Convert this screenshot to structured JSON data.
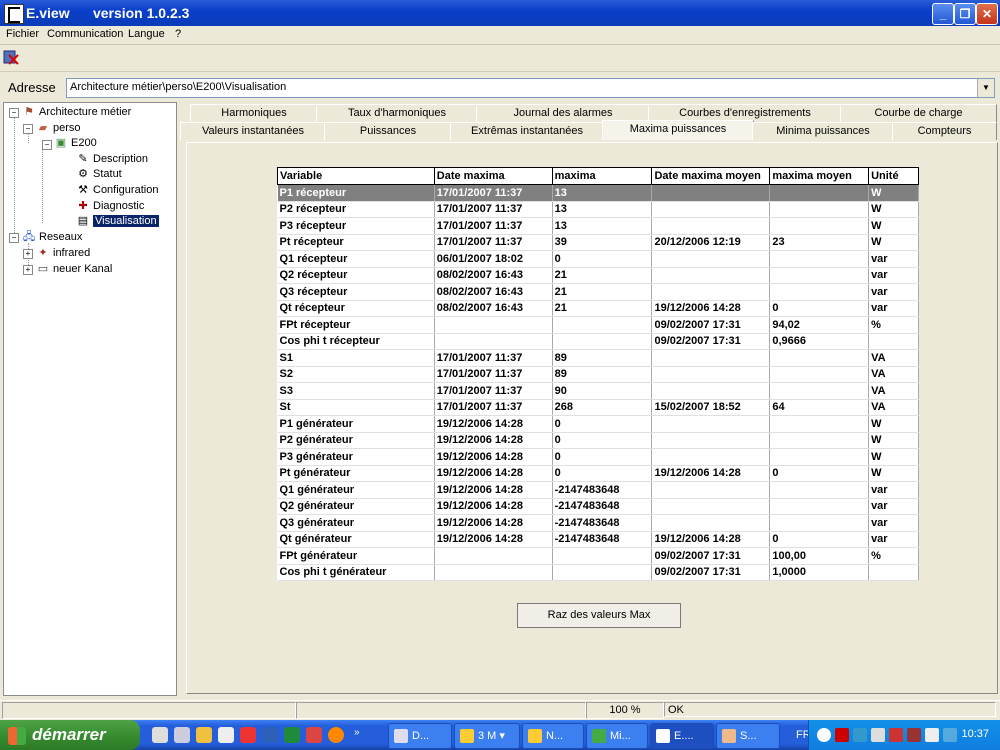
{
  "window": {
    "title": "E.view",
    "version": "version 1.0.2.3"
  },
  "menu": [
    "Fichier",
    "Communication",
    "Langue",
    "?"
  ],
  "address": {
    "label": "Adresse",
    "value": "Architecture métier\\perso\\E200\\Visualisation"
  },
  "tree": {
    "root": "Architecture métier",
    "perso": "perso",
    "device": "E200",
    "children": [
      "Description",
      "Statut",
      "Configuration",
      "Diagnostic",
      "Visualisation"
    ],
    "selected": "Visualisation",
    "networks": "Reseaux",
    "net_children": [
      "infrared",
      "neuer Kanal"
    ]
  },
  "tabs_row1": [
    "Harmoniques",
    "Taux d'harmoniques",
    "Journal des alarmes",
    "Courbes d'enregistrements",
    "Courbe de charge"
  ],
  "tabs_row2": [
    "Valeurs instantanées",
    "Puissances",
    "Extrêmas instantanées",
    "Maxima puissances",
    "Minima puissances",
    "Compteurs"
  ],
  "active_tab": "Maxima puissances",
  "table": {
    "headers": [
      "Variable",
      "Date maxima",
      "maxima",
      "Date maxima moyen",
      "maxima moyen",
      "Unité"
    ],
    "rows": [
      [
        "P1 récepteur",
        "17/01/2007 11:37",
        "13",
        "",
        "",
        "W"
      ],
      [
        "P2 récepteur",
        "17/01/2007 11:37",
        "13",
        "",
        "",
        "W"
      ],
      [
        "P3 récepteur",
        "17/01/2007 11:37",
        "13",
        "",
        "",
        "W"
      ],
      [
        "Pt récepteur",
        "17/01/2007 11:37",
        "39",
        "20/12/2006 12:19",
        "23",
        "W"
      ],
      [
        "Q1 récepteur",
        "06/01/2007 18:02",
        "0",
        "",
        "",
        "var"
      ],
      [
        "Q2 récepteur",
        "08/02/2007 16:43",
        "21",
        "",
        "",
        "var"
      ],
      [
        "Q3 récepteur",
        "08/02/2007 16:43",
        "21",
        "",
        "",
        "var"
      ],
      [
        "Qt récepteur",
        "08/02/2007 16:43",
        "21",
        "19/12/2006 14:28",
        "0",
        "var"
      ],
      [
        "FPt récepteur",
        "",
        "",
        "09/02/2007 17:31",
        "94,02",
        "%"
      ],
      [
        "Cos phi t récepteur",
        "",
        "",
        "09/02/2007 17:31",
        "0,9666",
        ""
      ],
      [
        "S1",
        "17/01/2007 11:37",
        "89",
        "",
        "",
        "VA"
      ],
      [
        "S2",
        "17/01/2007 11:37",
        "89",
        "",
        "",
        "VA"
      ],
      [
        "S3",
        "17/01/2007 11:37",
        "90",
        "",
        "",
        "VA"
      ],
      [
        "St",
        "17/01/2007 11:37",
        "268",
        "15/02/2007 18:52",
        "64",
        "VA"
      ],
      [
        "P1 générateur",
        "19/12/2006 14:28",
        "0",
        "",
        "",
        "W"
      ],
      [
        "P2 générateur",
        "19/12/2006 14:28",
        "0",
        "",
        "",
        "W"
      ],
      [
        "P3 générateur",
        "19/12/2006 14:28",
        "0",
        "",
        "",
        "W"
      ],
      [
        "Pt générateur",
        "19/12/2006 14:28",
        "0",
        "19/12/2006 14:28",
        "0",
        "W"
      ],
      [
        "Q1 générateur",
        "19/12/2006 14:28",
        "-2147483648",
        "",
        "",
        "var"
      ],
      [
        "Q2 générateur",
        "19/12/2006 14:28",
        "-2147483648",
        "",
        "",
        "var"
      ],
      [
        "Q3 générateur",
        "19/12/2006 14:28",
        "-2147483648",
        "",
        "",
        "var"
      ],
      [
        "Qt générateur",
        "19/12/2006 14:28",
        "-2147483648",
        "19/12/2006 14:28",
        "0",
        "var"
      ],
      [
        "FPt générateur",
        "",
        "",
        "09/02/2007 17:31",
        "100,00",
        "%"
      ],
      [
        "Cos phi t générateur",
        "",
        "",
        "09/02/2007 17:31",
        "1,0000",
        ""
      ]
    ],
    "selected_row": 0
  },
  "reset_button": "Raz des valeurs Max",
  "status": {
    "zoom": "100 %",
    "state": "OK"
  },
  "taskbar": {
    "start": "démarrer",
    "tasks": [
      "D...",
      "3 M",
      "N...",
      "Mi...",
      "E....",
      "S..."
    ],
    "lang": "FR",
    "clock": "10:37"
  },
  "colors": {
    "titlebar": "#0a3fc9",
    "selection": "#0a246a",
    "row_highlight": "#808080",
    "taskbar": "#245edb",
    "start": "#378d2f"
  }
}
